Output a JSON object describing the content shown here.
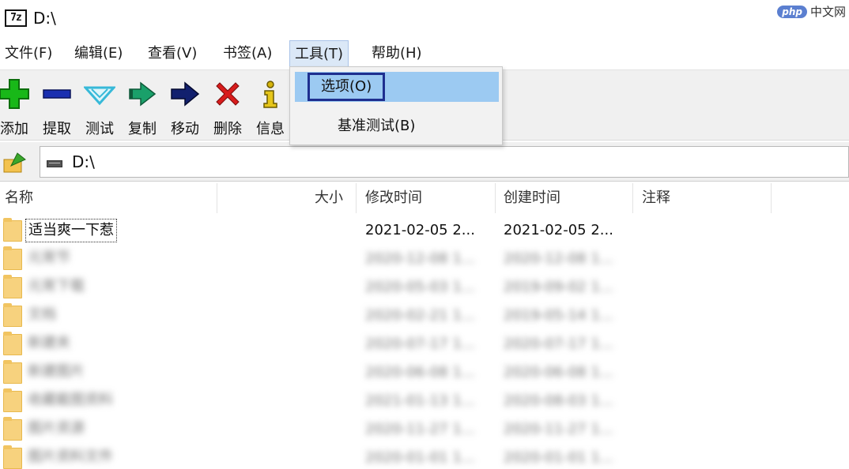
{
  "window": {
    "app_icon": "7z",
    "title": "D:\\"
  },
  "watermark": {
    "badge": "php",
    "text": "中文网"
  },
  "menu": [
    "文件(F)",
    "编辑(E)",
    "查看(V)",
    "书签(A)",
    "工具(T)",
    "帮助(H)"
  ],
  "toolbar": [
    {
      "label": "添加",
      "icon": "add-icon",
      "color": "#18b818"
    },
    {
      "label": "提取",
      "icon": "extract-icon",
      "color": "#1a2fb0"
    },
    {
      "label": "测试",
      "icon": "test-icon",
      "color": "#37b9d8"
    },
    {
      "label": "复制",
      "icon": "copy-icon",
      "color": "#1aa06a"
    },
    {
      "label": "移动",
      "icon": "move-icon",
      "color": "#12206e"
    },
    {
      "label": "删除",
      "icon": "delete-icon",
      "color": "#d81c1c"
    },
    {
      "label": "信息",
      "icon": "info-icon",
      "color": "#d6b40a"
    }
  ],
  "tools_menu": {
    "items": [
      "选项(O)",
      "基准测试(B)"
    ],
    "highlighted": "选项(O)"
  },
  "address": {
    "path": "D:\\"
  },
  "columns": [
    "名称",
    "大小",
    "修改时间",
    "创建时间",
    "注释"
  ],
  "files": [
    {
      "name": "适当爽一下惹",
      "modified": "2021-02-05 2...",
      "created": "2021-02-05 2...",
      "blurred": false
    },
    {
      "name": "元宵节",
      "modified": "2020-12-08 1...",
      "created": "2020-12-08 1...",
      "blurred": true
    },
    {
      "name": "元宵下载",
      "modified": "2020-05-03 1...",
      "created": "2019-09-02 1...",
      "blurred": true
    },
    {
      "name": "文档",
      "modified": "2020-02-21 1...",
      "created": "2019-05-14 1...",
      "blurred": true
    },
    {
      "name": "新建夹",
      "modified": "2020-07-17 1...",
      "created": "2020-07-17 1...",
      "blurred": true
    },
    {
      "name": "新建图片",
      "modified": "2020-06-08 1...",
      "created": "2020-06-08 1...",
      "blurred": true
    },
    {
      "name": "收藏截图资料",
      "modified": "2021-01-13 1...",
      "created": "2020-08-03 1...",
      "blurred": true
    },
    {
      "name": "图片资源",
      "modified": "2020-11-27 1...",
      "created": "2020-11-27 1...",
      "blurred": true
    },
    {
      "name": "图片资料文件",
      "modified": "2020-01-01 1...",
      "created": "2020-01-01 1...",
      "blurred": true
    }
  ]
}
